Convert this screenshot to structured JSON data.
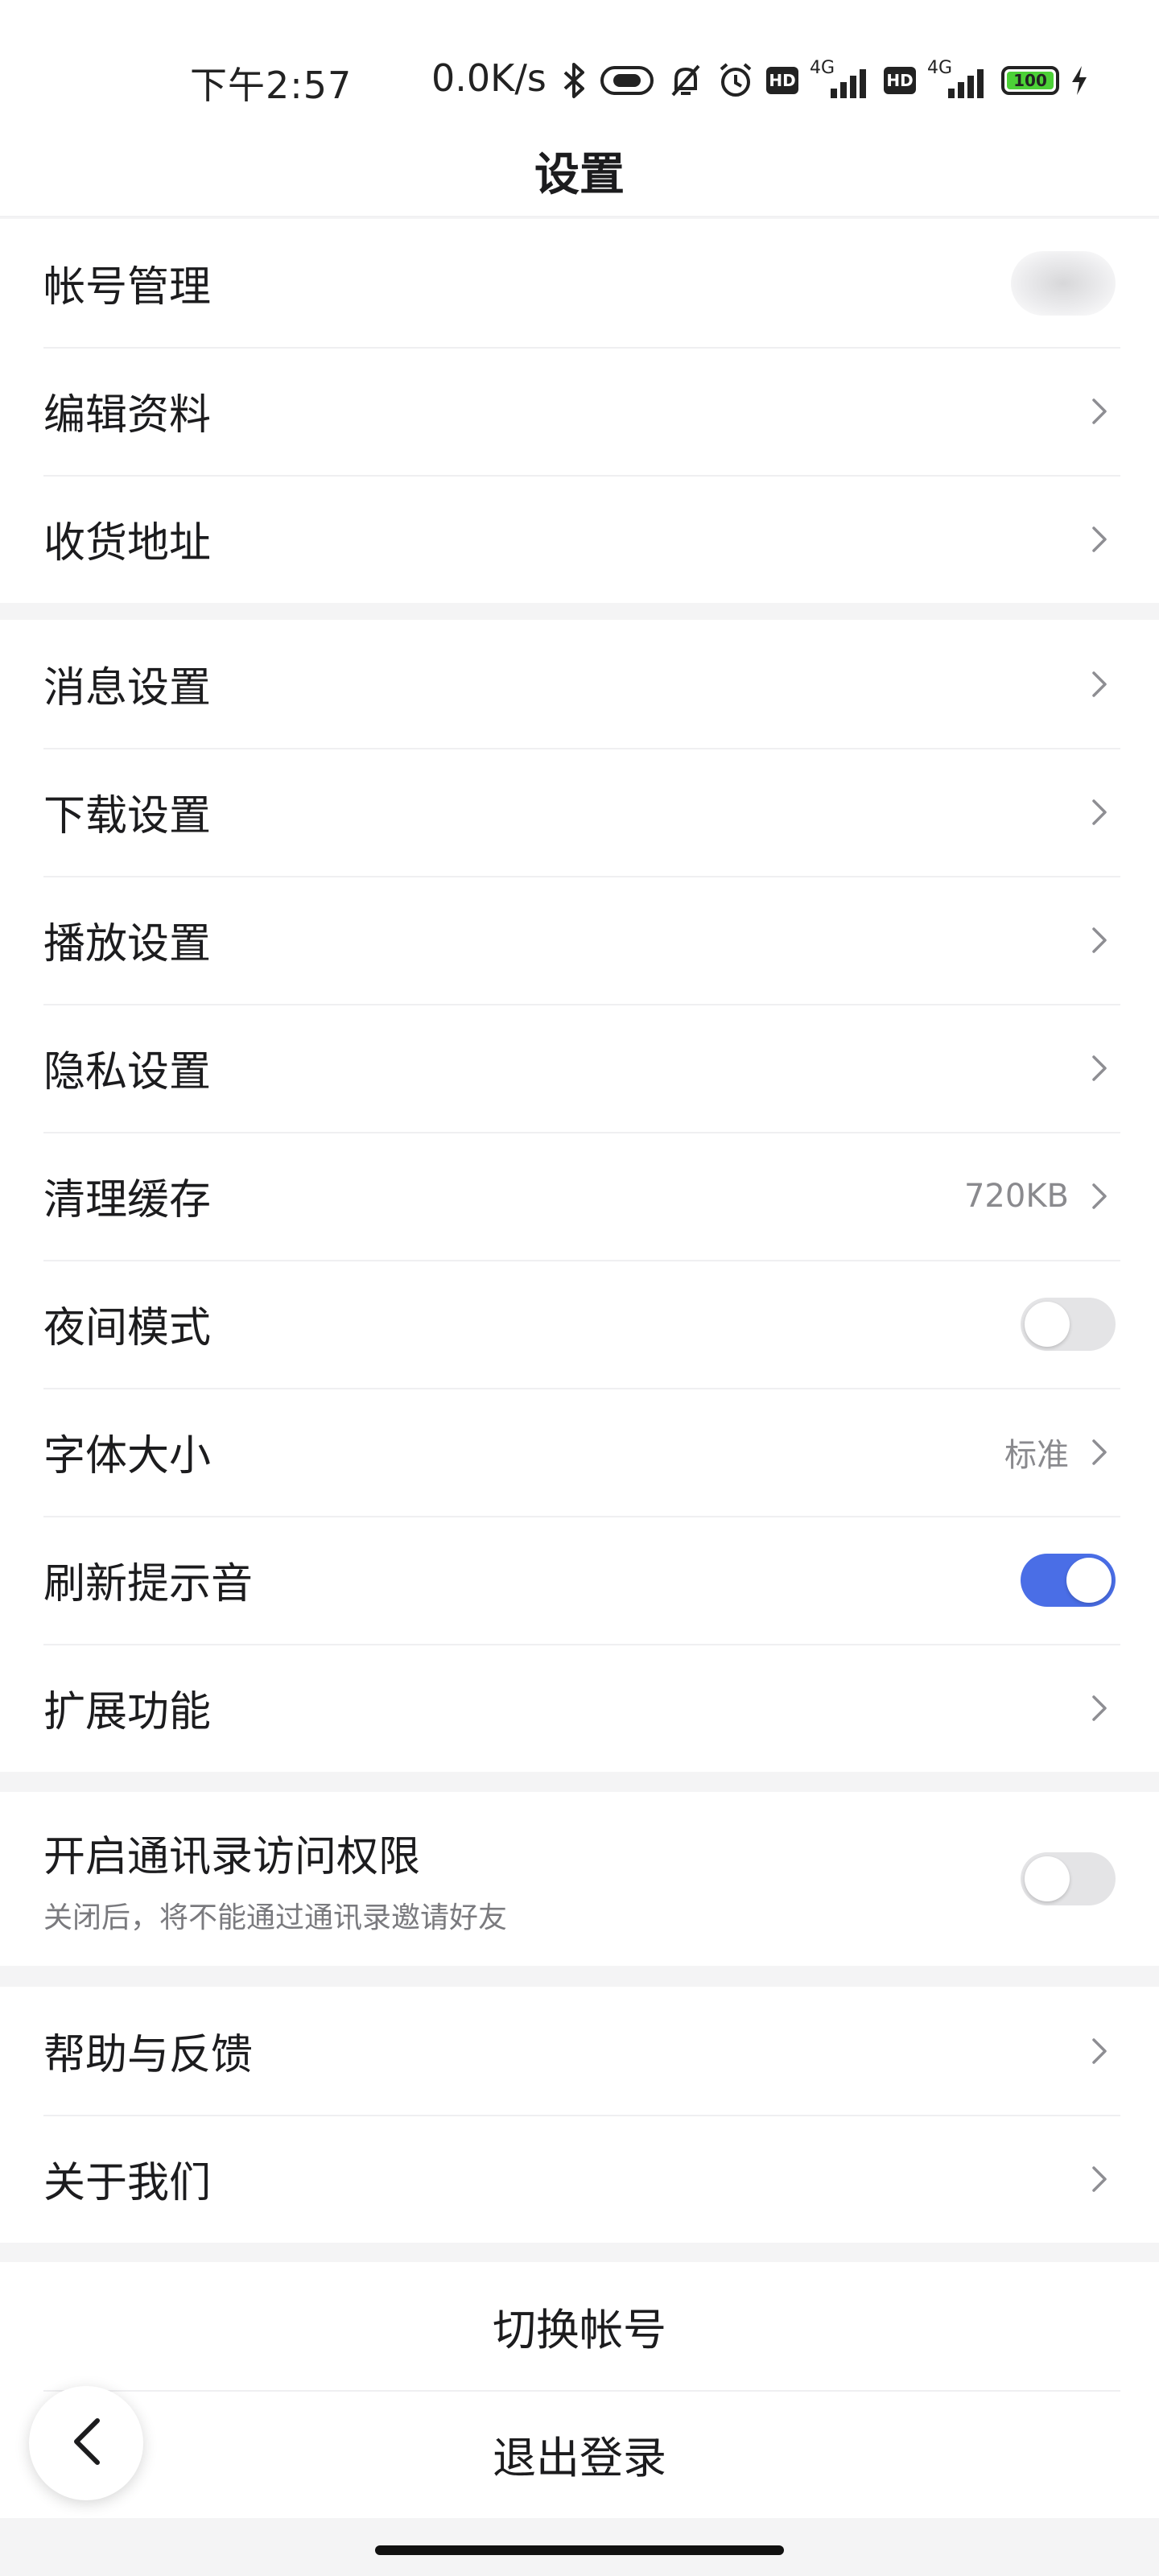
{
  "status_bar": {
    "time": "下午2:57",
    "net_speed": "0.0K/s",
    "hd1": "HD",
    "net1": "4G",
    "hd2": "HD",
    "net2": "4G",
    "battery": "100"
  },
  "header": {
    "title": "设置"
  },
  "account_group": [
    {
      "label": "帐号管理"
    },
    {
      "label": "编辑资料"
    },
    {
      "label": "收货地址"
    }
  ],
  "settings_group": {
    "message": "消息设置",
    "download": "下载设置",
    "playback": "播放设置",
    "privacy": "隐私设置",
    "cache": {
      "label": "清理缓存",
      "value": "720KB"
    },
    "night_mode": {
      "label": "夜间模式",
      "on": false
    },
    "font_size": {
      "label": "字体大小",
      "value": "标准"
    },
    "refresh_sound": {
      "label": "刷新提示音",
      "on": true
    },
    "extensions": "扩展功能"
  },
  "contacts_group": {
    "label": "开启通讯录访问权限",
    "sublabel": "关闭后，将不能通过通讯录邀请好友",
    "on": false
  },
  "help_group": [
    {
      "label": "帮助与反馈"
    },
    {
      "label": "关于我们"
    }
  ],
  "actions": {
    "switch_account": "切换帐号",
    "logout": "退出登录"
  },
  "colors": {
    "toggle_on": "#4a6ee6",
    "toggle_off": "#e4e4e6",
    "battery_fill": "#4cd137",
    "page_bg": "#f4f4f5"
  }
}
